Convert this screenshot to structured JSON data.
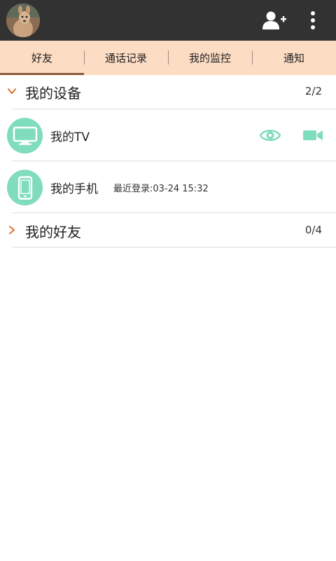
{
  "header": {
    "avatar_icon": "kangaroo-avatar",
    "add_friend_icon": "add-user-icon",
    "more_icon": "more-vertical-icon",
    "background": "#323232"
  },
  "tabs": [
    {
      "label": "好友",
      "active": true
    },
    {
      "label": "通话记录",
      "active": false
    },
    {
      "label": "我的监控",
      "active": false
    },
    {
      "label": "通知",
      "active": false
    }
  ],
  "groups": {
    "devices": {
      "title": "我的设备",
      "count": "2/2",
      "expanded": true,
      "items": [
        {
          "name": "我的TV",
          "icon": "tv-icon"
        },
        {
          "name": "我的手机",
          "icon": "phone-icon",
          "sub": "最近登录:03-24 15:32"
        }
      ]
    },
    "friends": {
      "title": "我的好友",
      "count": "0/4",
      "expanded": false
    }
  },
  "colors": {
    "accent": "#7fdcbc",
    "tab_bar": "#fddcc4",
    "chevron": "#d9742c"
  }
}
